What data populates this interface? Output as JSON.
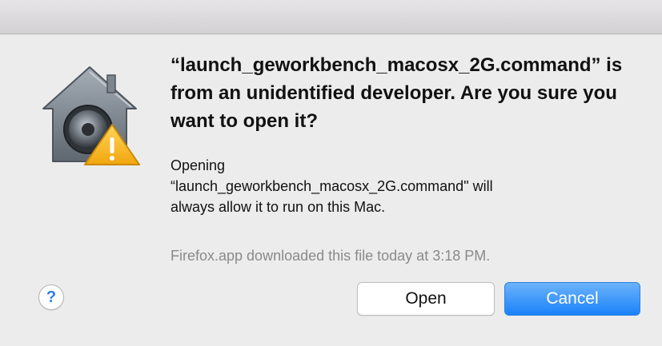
{
  "dialog": {
    "headline": "“launch_geworkbench_macosx_2G.command” is from an unidentified developer. Are you sure you want to open it?",
    "body_lines": [
      "Opening",
      "“launch_geworkbench_macosx_2G.command\" will",
      "always allow it to run on this Mac."
    ],
    "download_info": "Firefox.app downloaded this file today at 3:18 PM.",
    "icon": "gatekeeper-security-warning-icon"
  },
  "buttons": {
    "help_label": "?",
    "open_label": "Open",
    "cancel_label": "Cancel"
  },
  "colors": {
    "background": "#ececec",
    "accent": "#1a82fb",
    "warning": "#f5b21d",
    "secondary_text": "#8a8a8a"
  }
}
